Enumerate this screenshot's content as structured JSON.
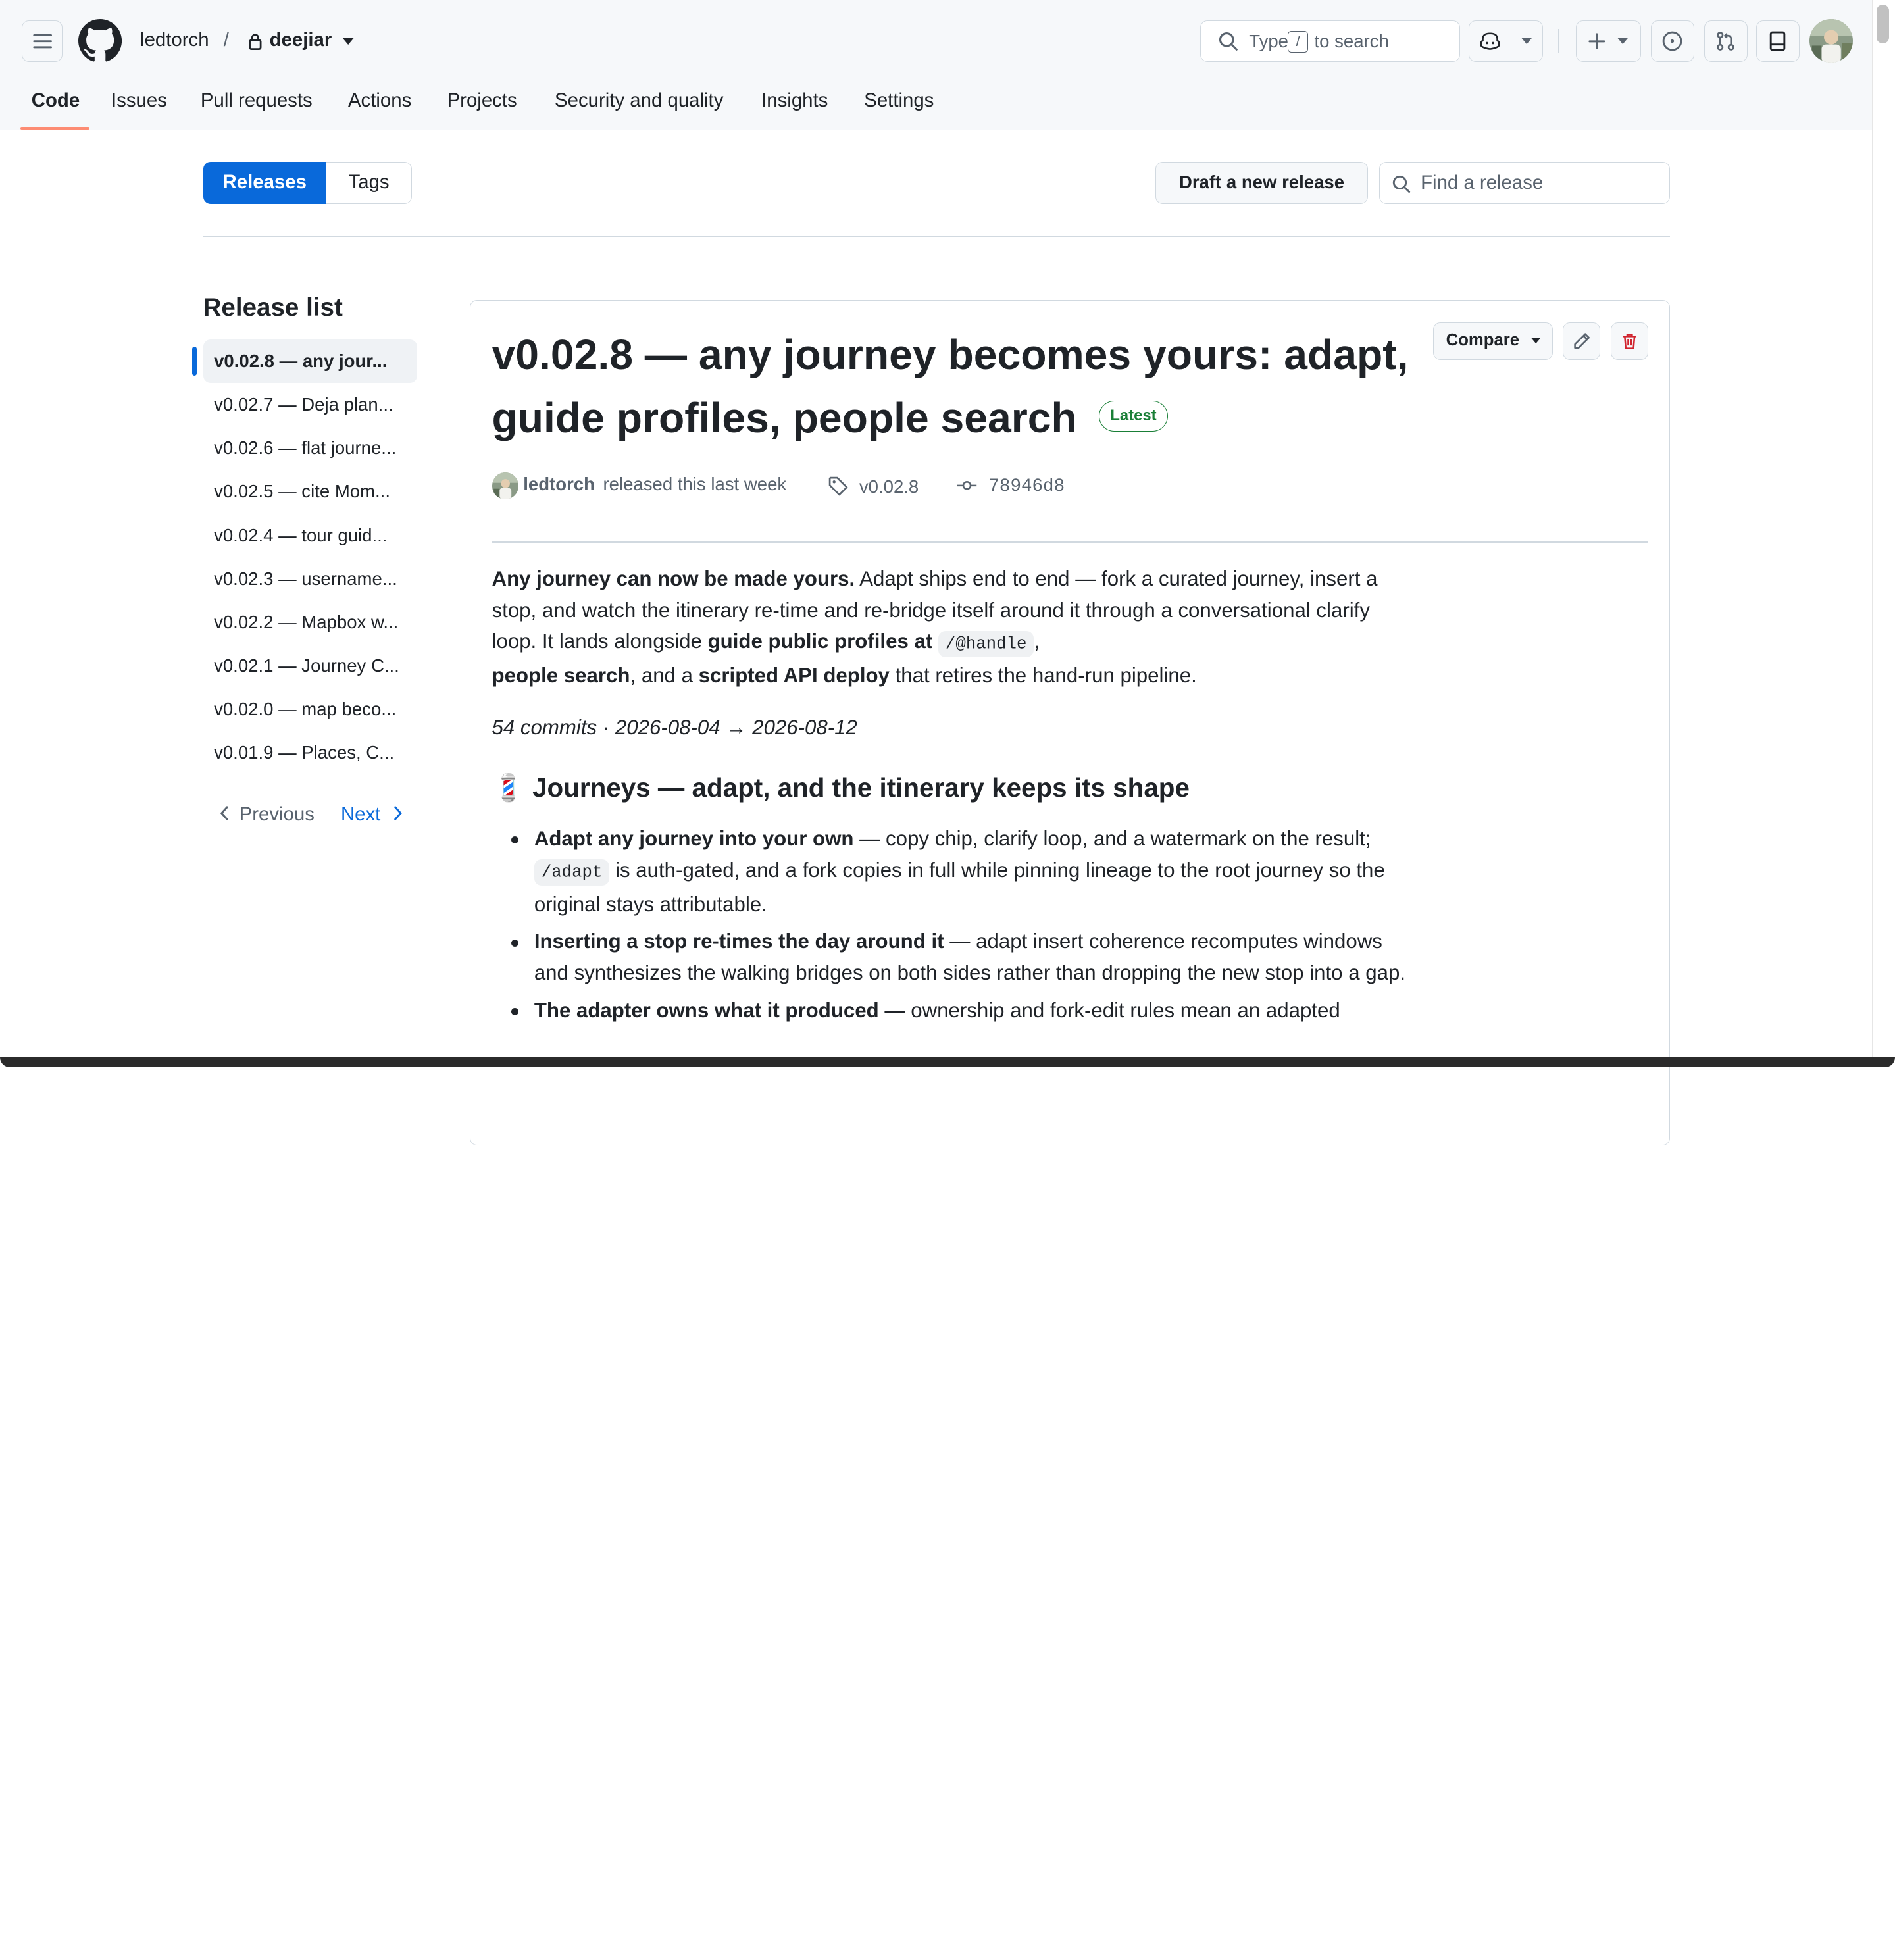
{
  "header": {
    "owner": "ledtorch",
    "separator": "/",
    "repo": "deejiar",
    "search": {
      "prefix": "Type",
      "key": "/",
      "suffix": "to search"
    }
  },
  "tabs": [
    "Code",
    "Issues",
    "Pull requests",
    "Actions",
    "Projects",
    "Security and quality",
    "Insights",
    "Settings"
  ],
  "subnav": {
    "releases_label": "Releases",
    "tags_label": "Tags",
    "draft_label": "Draft a new release",
    "find_placeholder": "Find a release"
  },
  "release_list": {
    "title": "Release list",
    "items": [
      "v0.02.8 — any jour...",
      "v0.02.7 — Deja plan...",
      "v0.02.6 — flat journe...",
      "v0.02.5 — cite Mom...",
      "v0.02.4 — tour guid...",
      "v0.02.3 — username...",
      "v0.02.2 — Mapbox w...",
      "v0.02.1 — Journey C...",
      "v0.02.0 — map beco...",
      "v0.01.9 — Places, C..."
    ],
    "previous_label": "Previous",
    "next_label": "Next"
  },
  "release": {
    "title": "v0.02.8 — any journey becomes yours: adapt, guide profiles, people search",
    "badge": "Latest",
    "compare_label": "Compare",
    "author": "ledtorch",
    "released_text": "released this last week",
    "tag": "v0.02.8",
    "commit": "78946d8",
    "intro": {
      "lead_bold": "Any journey can now be made yours.",
      "text1": " Adapt ships end to end — fork a curated journey, insert a stop, and watch the itinerary re-time and re-bridge itself around it through a conversational clarify loop. It lands alongside ",
      "bold2": "guide public profiles at",
      "code1": "/@handle",
      "text2": ",",
      "bold3": "people search",
      "text3": ", and a ",
      "bold4": "scripted API deploy",
      "text4": " that retires the hand-run pipeline."
    },
    "summary": "54 commits · 2026-08-04 → 2026-08-12",
    "section_emoji": "💈",
    "section_title": "Journeys — adapt, and the itinerary keeps its shape",
    "bullets": [
      {
        "bold": "Adapt any journey into your own",
        "text_a": " — copy chip, clarify loop, and a watermark on the result; ",
        "code": "/adapt",
        "text_b": " is auth-gated, and a fork copies in full while pinning lineage to the root journey so the original stays attributable."
      },
      {
        "bold": "Inserting a stop re-times the day around it",
        "text_a": " — adapt insert coherence recomputes windows and synthesizes the walking bridges on both sides rather than dropping the new stop into a gap.",
        "code": "",
        "text_b": ""
      },
      {
        "bold": "The adapter owns what it produced",
        "text_a": " — ownership and fork-edit rules mean an adapted",
        "code": "",
        "text_b": ""
      }
    ]
  },
  "colors": {
    "accent": "#0969da",
    "tab_underline": "#fd8c73",
    "latest_green": "#1a7f37",
    "danger": "#d1242f",
    "border": "#d1d9e0",
    "muted_text": "#59636e"
  }
}
